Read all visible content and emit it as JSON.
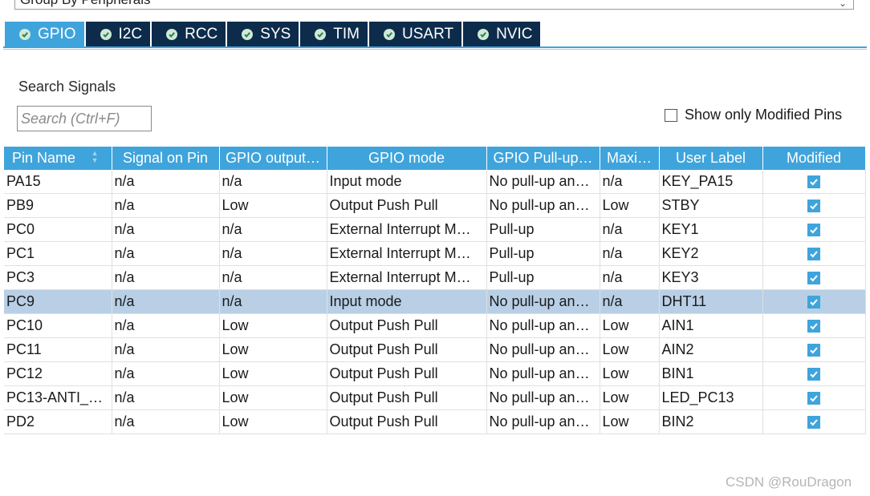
{
  "group_select": {
    "value": "Group By Peripherals"
  },
  "tabs": [
    {
      "label": "GPIO",
      "icon": "check-circle-icon",
      "active": true
    },
    {
      "label": "I2C",
      "icon": "check-circle-icon"
    },
    {
      "label": "RCC",
      "icon": "check-circle-icon"
    },
    {
      "label": "SYS",
      "icon": "check-circle-icon"
    },
    {
      "label": "TIM",
      "icon": "check-circle-icon"
    },
    {
      "label": "USART",
      "icon": "check-circle-icon"
    },
    {
      "label": "NVIC",
      "icon": "check-circle-icon"
    }
  ],
  "search": {
    "label": "Search Signals",
    "placeholder": "Search (Ctrl+F)",
    "value": ""
  },
  "modified_filter": {
    "label": "Show only Modified Pins",
    "checked": false
  },
  "table": {
    "columns": [
      "Pin Name",
      "Signal on Pin",
      "GPIO output…",
      "GPIO mode",
      "GPIO Pull-up…",
      "Maxi…",
      "User Label",
      "Modified"
    ],
    "rows": [
      {
        "cells": [
          "PA15",
          "n/a",
          "n/a",
          "Input mode",
          "No pull-up an…",
          "n/a",
          "KEY_PA15"
        ],
        "modified": true
      },
      {
        "cells": [
          "PB9",
          "n/a",
          "Low",
          "Output Push Pull",
          "No pull-up an…",
          "Low",
          "STBY"
        ],
        "modified": true
      },
      {
        "cells": [
          "PC0",
          "n/a",
          "n/a",
          "External Interrupt M…",
          "Pull-up",
          "n/a",
          "KEY1"
        ],
        "modified": true
      },
      {
        "cells": [
          "PC1",
          "n/a",
          "n/a",
          "External Interrupt M…",
          "Pull-up",
          "n/a",
          "KEY2"
        ],
        "modified": true
      },
      {
        "cells": [
          "PC3",
          "n/a",
          "n/a",
          "External Interrupt M…",
          "Pull-up",
          "n/a",
          "KEY3"
        ],
        "modified": true
      },
      {
        "cells": [
          "PC9",
          "n/a",
          "n/a",
          "Input mode",
          "No pull-up an…",
          "n/a",
          "DHT11"
        ],
        "modified": true,
        "selected": true
      },
      {
        "cells": [
          "PC10",
          "n/a",
          "Low",
          "Output Push Pull",
          "No pull-up an…",
          "Low",
          "AIN1"
        ],
        "modified": true
      },
      {
        "cells": [
          "PC11",
          "n/a",
          "Low",
          "Output Push Pull",
          "No pull-up an…",
          "Low",
          "AIN2"
        ],
        "modified": true
      },
      {
        "cells": [
          "PC12",
          "n/a",
          "Low",
          "Output Push Pull",
          "No pull-up an…",
          "Low",
          "BIN1"
        ],
        "modified": true
      },
      {
        "cells": [
          "PC13-ANTI_…",
          "n/a",
          "Low",
          "Output Push Pull",
          "No pull-up an…",
          "Low",
          "LED_PC13"
        ],
        "modified": true
      },
      {
        "cells": [
          "PD2",
          "n/a",
          "Low",
          "Output Push Pull",
          "No pull-up an…",
          "Low",
          "BIN2"
        ],
        "modified": true
      }
    ]
  },
  "watermark": "CSDN @RouDragon",
  "colors": {
    "accent": "#3fa4dc",
    "tab_bg": "#0d2c4c",
    "selected_row": "#b8cfe6"
  }
}
